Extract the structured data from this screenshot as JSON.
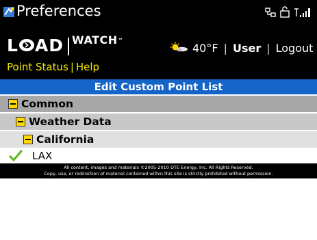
{
  "statusbar": {
    "app_title": "Preferences",
    "app_icon": "blackberry-preferences-icon",
    "sys_icons": [
      "network-icon",
      "lock-icon",
      "signal-icon"
    ]
  },
  "header": {
    "logo_load": "L",
    "logo_load_rest": "AD",
    "logo_watch": "WATCH",
    "logo_tm": "™",
    "weather_icon": "sun-cloud-icon",
    "temperature": "40°F",
    "separator": "|",
    "user": "User",
    "logout": "Logout"
  },
  "nav": {
    "point_status": "Point Status",
    "separator": "|",
    "help": "Help"
  },
  "page_title": "Edit Custom Point List",
  "tree": {
    "common": "Common",
    "weather_data": "Weather Data",
    "california": "California",
    "lax": "LAX"
  },
  "colors": {
    "title_bar": "#1565c8",
    "nav_link": "#f2e600",
    "toggle": "#ffd800",
    "checkmark": "#5fb82a"
  },
  "footer": {
    "line1": "All content, images and materials ©2005-2010 DTE Energy, Inc. All Rights Reserved.",
    "line2": "Copy, use, or redirection of material contained within this site is strictly prohibited without permission."
  }
}
